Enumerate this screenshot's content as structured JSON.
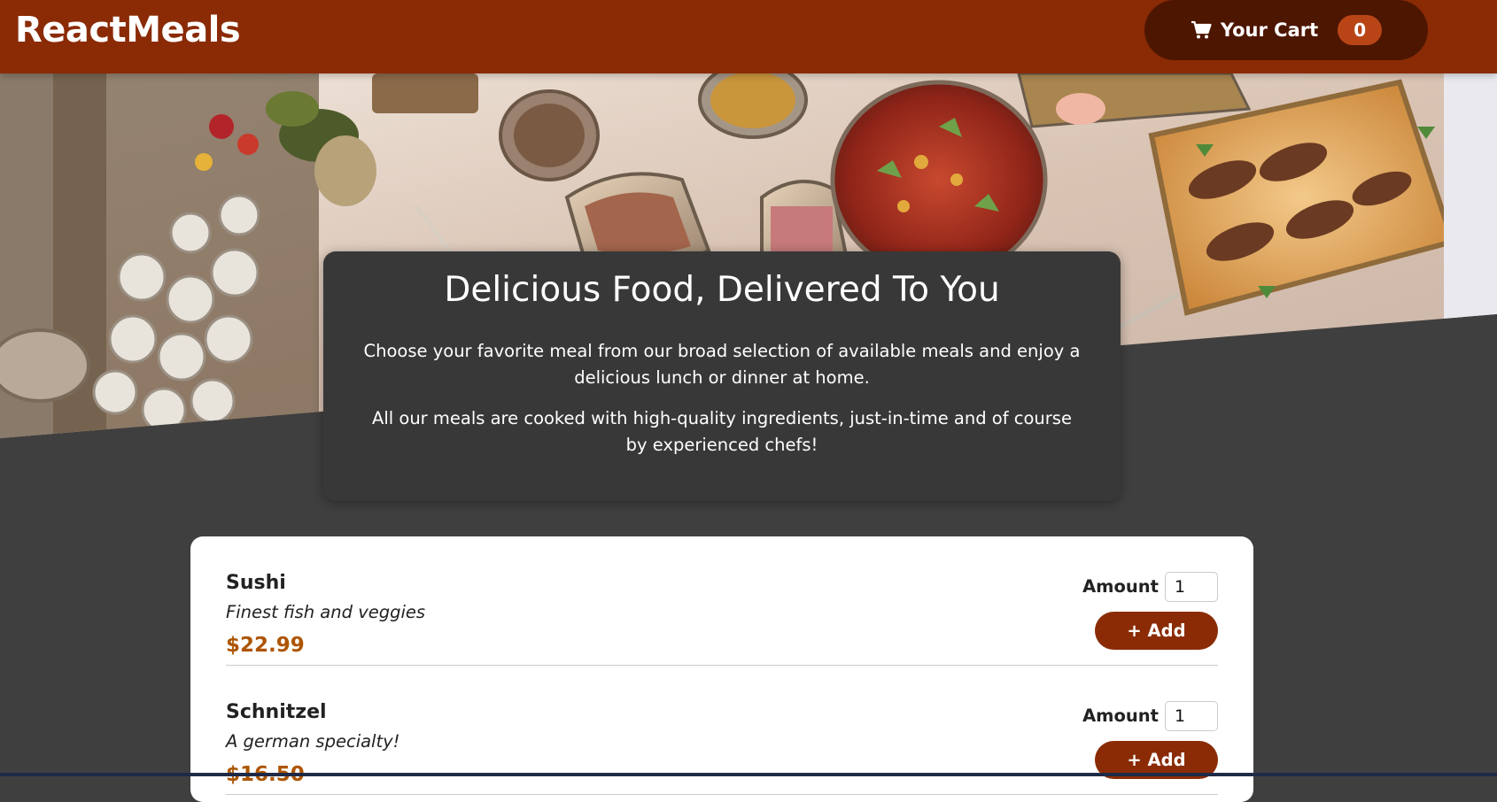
{
  "header": {
    "logo": "ReactMeals",
    "cart": {
      "label": "Your Cart",
      "count": "0",
      "icon": "cart-icon"
    }
  },
  "hero": {
    "image": "banquet-table-food-photo"
  },
  "summary": {
    "title": "Delicious Food, Delivered To You",
    "paragraph1": "Choose your favorite meal from our broad selection of available meals and enjoy a delicious lunch or dinner at home.",
    "paragraph2": "All our meals are cooked with high-quality ingredients, just-in-time and of course by experienced chefs!"
  },
  "meals": [
    {
      "name": "Sushi",
      "description": "Finest fish and veggies",
      "price": "$22.99",
      "amount_label": "Amount",
      "amount_value": "1",
      "add_label": "+ Add"
    },
    {
      "name": "Schnitzel",
      "description": "A german specialty!",
      "price": "$16.50",
      "amount_label": "Amount",
      "amount_value": "1",
      "add_label": "+ Add"
    }
  ],
  "colors": {
    "header": "#8a2b06",
    "cart_button": "#4d1601",
    "badge": "#b94517",
    "background": "#3f3f3f",
    "summary_card": "#383838",
    "price": "#ad5502"
  }
}
